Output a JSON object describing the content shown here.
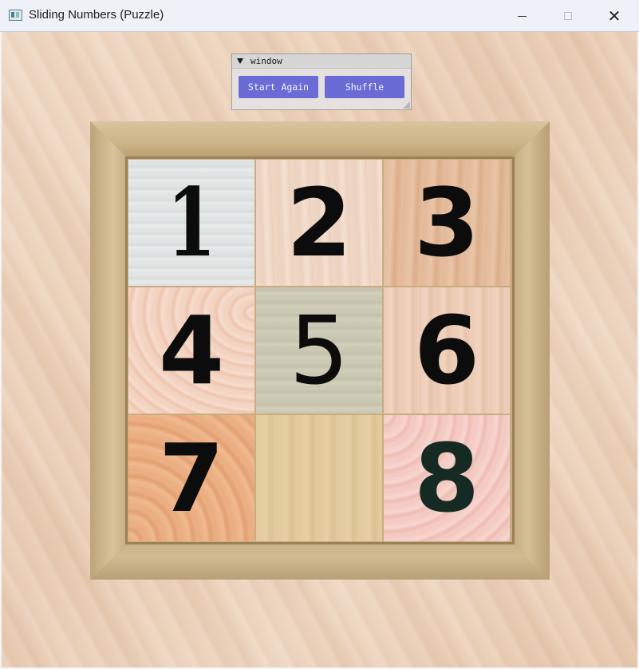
{
  "window": {
    "title": "Sliding Numbers (Puzzle)",
    "controls": {
      "minimize_icon": "minimize-icon",
      "maximize_icon": "maximize-icon",
      "close_glyph": "✕"
    }
  },
  "panel": {
    "title": "window",
    "buttons": {
      "start_again": "Start Again",
      "shuffle": "Shuffle"
    },
    "button_color": "#6a6bd4"
  },
  "board": {
    "tiles": [
      "1",
      "2",
      "3",
      "4",
      "5",
      "6",
      "7",
      "",
      "8"
    ],
    "empty_index": 7
  }
}
